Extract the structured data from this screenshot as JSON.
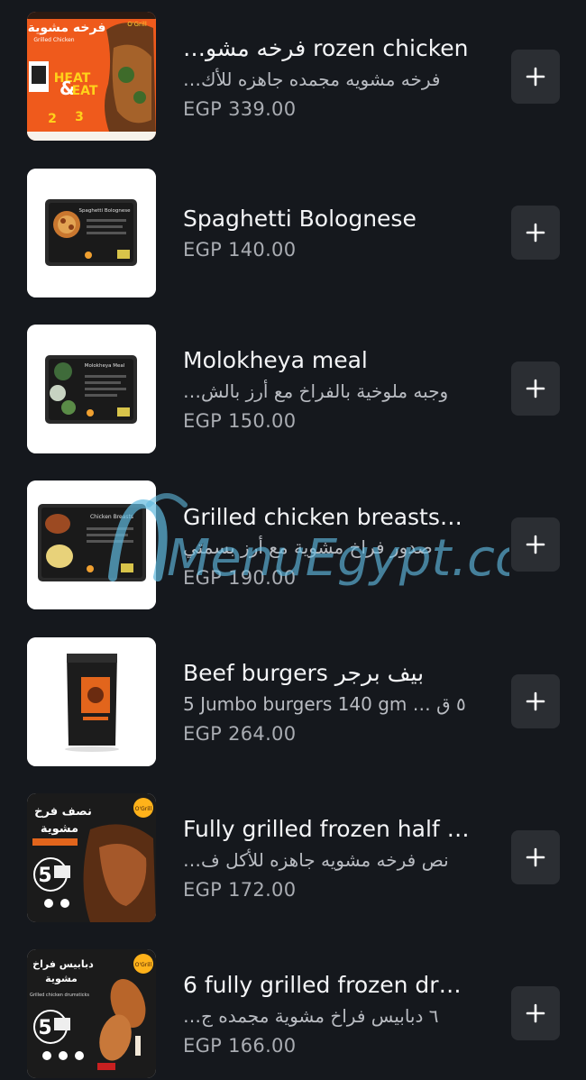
{
  "items": [
    {
      "title": "rozen chicken  فرخه مشو…",
      "description": "فرخه مشويه مجمده جاهزه للأك…",
      "price": "EGP 339.00",
      "image": "Grilled chicken package photo",
      "image_text": [
        "فرخه مشوية",
        "Grilled Chicken",
        "HEAT",
        "&",
        "EAT",
        "2",
        "3",
        "O'Grill"
      ]
    },
    {
      "title": "Spaghetti Bolognese",
      "description": "",
      "price": "EGP 140.00",
      "image": "Spaghetti Bolognese tray photo",
      "image_text": [
        "Spaghetti Bolognese"
      ]
    },
    {
      "title": "Molokheya meal",
      "description": "وجبه ملوخية بالفراخ مع أرز بالش…",
      "price": "EGP 150.00",
      "image": "Molokheya meal tray photo",
      "image_text": [
        "Molokheya Meal"
      ]
    },
    {
      "title": "Grilled chicken breasts…",
      "description": "صدور فراخ مشوية مع أرز بسمتي",
      "price": "EGP 190.00",
      "image": "Chicken breasts tray photo",
      "image_text": [
        "Chicken Breasts"
      ]
    },
    {
      "title": "Beef burgers بيف برجر",
      "description": "5 Jumbo burgers 140 gm … ٥ ق",
      "price": "EGP 264.00",
      "image": "Beef burgers pouch photo",
      "image_text": []
    },
    {
      "title": "Fully grilled frozen half …",
      "description": "نص فرخه مشويه جاهزه للأكل ف…",
      "price": "EGP 172.00",
      "image": "Half grilled chicken package photo",
      "image_text": [
        "نصف فرخ",
        "مشوية",
        "5",
        "O'Grill"
      ]
    },
    {
      "title": "6 fully grilled frozen dr…",
      "description": "٦ دبابيس فراخ مشوية مجمده ج…",
      "price": "EGP 166.00",
      "image": "Grilled chicken drumsticks package photo",
      "image_text": [
        "دبابيس فراخ",
        "مشوية",
        "Grilled chicken drumsticks",
        "5",
        "O'Grill"
      ]
    }
  ],
  "add_button_icon": "plus-icon",
  "watermark": "MenuEgypt.com",
  "colors": {
    "background": "#15181d",
    "button": "#2b2e33",
    "title": "#f4f5f7",
    "description": "#b9bcc2",
    "price": "#a9acb2",
    "watermark": "#5fb9de"
  }
}
